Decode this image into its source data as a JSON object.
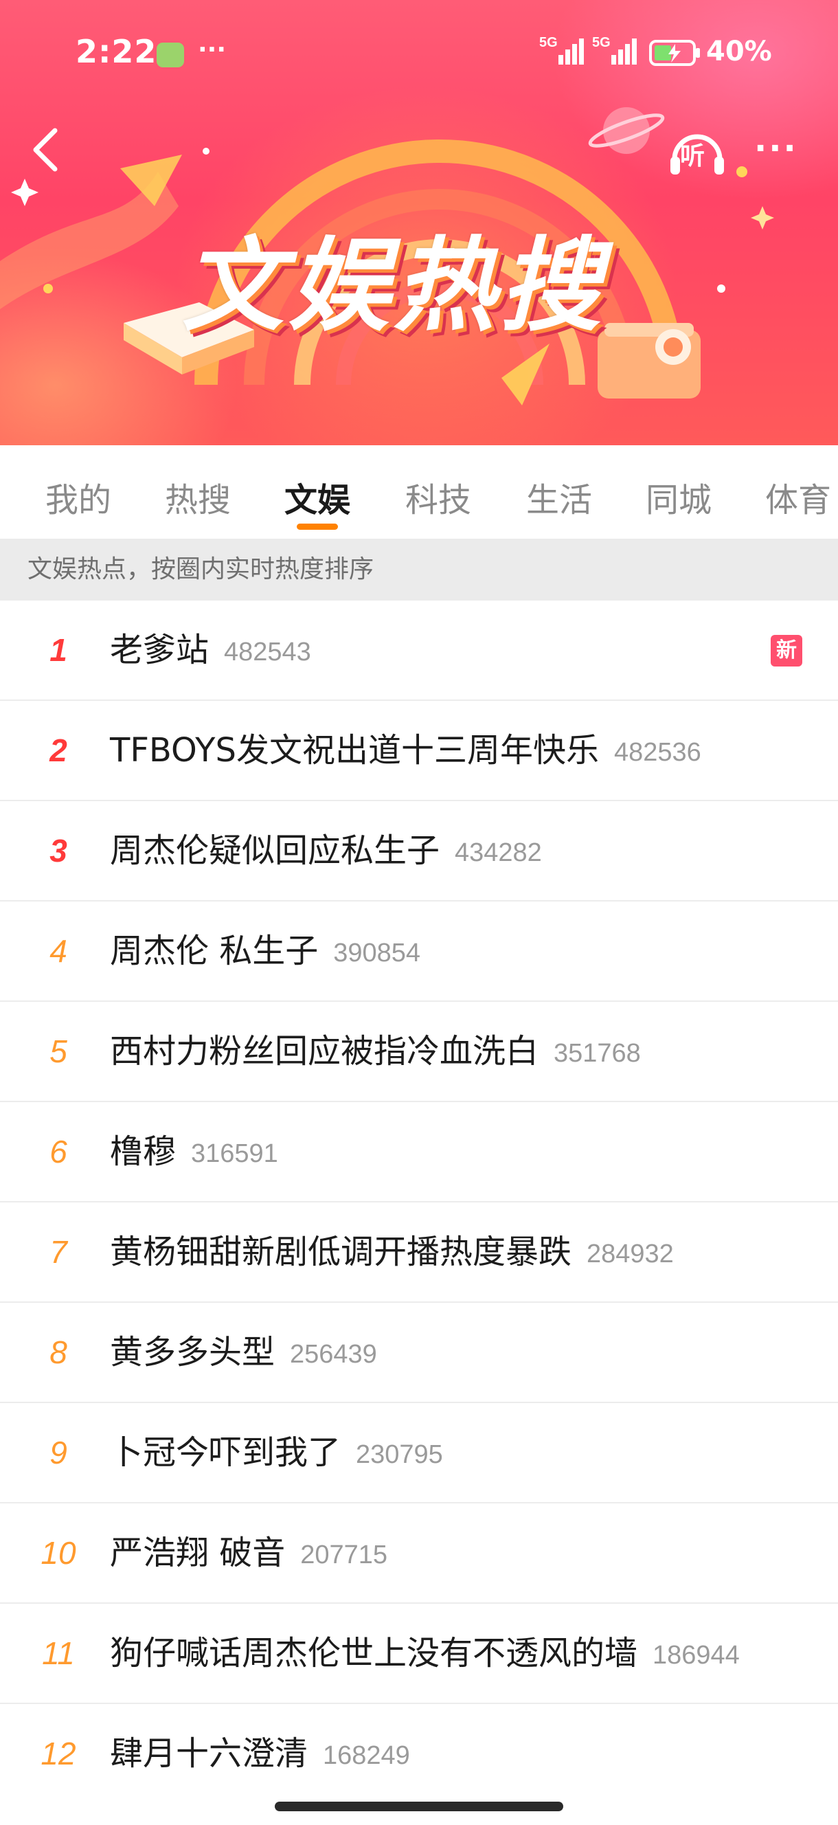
{
  "status_bar": {
    "time": "2:22",
    "dots": "···",
    "net1": "5G",
    "net2": "5G",
    "battery_percent": "40%"
  },
  "header": {
    "title": "文娱热搜",
    "listen_label": "听",
    "more": "···"
  },
  "tabs": [
    {
      "label": "我的"
    },
    {
      "label": "热搜"
    },
    {
      "label": "文娱",
      "active": true
    },
    {
      "label": "科技"
    },
    {
      "label": "生活"
    },
    {
      "label": "同城"
    },
    {
      "label": "体育"
    }
  ],
  "subheader": "文娱热点，按圈内实时热度排序",
  "items": [
    {
      "rank": "1",
      "title": "老爹站",
      "count": "482543",
      "badge": "新"
    },
    {
      "rank": "2",
      "title": "TFBOYS发文祝出道十三周年快乐",
      "count": "482536"
    },
    {
      "rank": "3",
      "title": "周杰伦疑似回应私生子",
      "count": "434282"
    },
    {
      "rank": "4",
      "title": "周杰伦 私生子",
      "count": "390854"
    },
    {
      "rank": "5",
      "title": "西村力粉丝回应被指冷血洗白",
      "count": "351768"
    },
    {
      "rank": "6",
      "title": "橹穆",
      "count": "316591"
    },
    {
      "rank": "7",
      "title": "黄杨钿甜新剧低调开播热度暴跌",
      "count": "284932"
    },
    {
      "rank": "8",
      "title": "黄多多头型",
      "count": "256439"
    },
    {
      "rank": "9",
      "title": "卜冠今吓到我了",
      "count": "230795"
    },
    {
      "rank": "10",
      "title": "严浩翔 破音",
      "count": "207715"
    },
    {
      "rank": "11",
      "title": "狗仔喊话周杰伦世上没有不透风的墙",
      "count": "186944"
    },
    {
      "rank": "12",
      "title": "肆月十六澄清",
      "count": "168249"
    }
  ],
  "colors": {
    "accent": "#ff8200",
    "rank_top": "#ff3a3a",
    "rank_other": "#ff9a2e",
    "badge": "#ff4f6e"
  }
}
